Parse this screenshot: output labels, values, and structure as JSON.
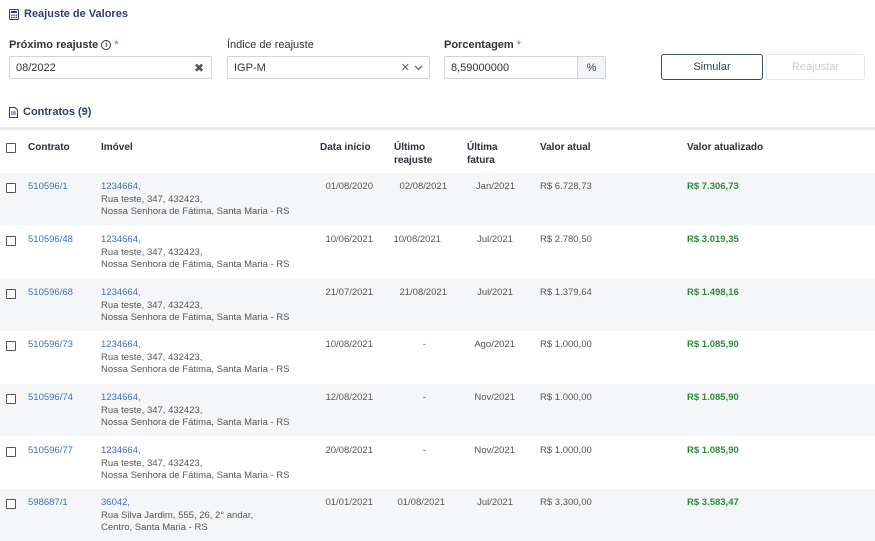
{
  "header": {
    "title": "Reajuste de Valores",
    "icon": "calculator-icon"
  },
  "form": {
    "next_adjustment": {
      "label": "Próximo reajuste",
      "required_mark": "*",
      "value": "08/2022"
    },
    "index": {
      "label": "Índice de reajuste",
      "value": "IGP-M"
    },
    "percentage": {
      "label": "Porcentagem",
      "required_mark": "*",
      "value": "8,59000000",
      "addon": "%"
    },
    "simulate_label": "Simular",
    "adjust_label": "Reajustar"
  },
  "contracts": {
    "title": "Contratos (9)",
    "icon": "document-icon"
  },
  "table": {
    "headers": {
      "contract": "Contrato",
      "property": "Imóvel",
      "start_date": "Data início",
      "last_adjustment_1": "Último",
      "last_adjustment_2": "reajuste",
      "last_invoice_1": "Última",
      "last_invoice_2": "fatura",
      "current_value": "Valor atual",
      "updated_value": "Valor atualizado"
    },
    "rows": [
      {
        "contract": "510596/1",
        "property_code": "1234664,",
        "address1": "Rua teste, 347, 432423,",
        "address2": "Nossa Senhora de Fátima, Santa Maria - RS",
        "start_date": "01/08/2020",
        "last_adjustment": "02/08/2021",
        "last_invoice": "Jan/2021",
        "current_value": "R$ 6.728,73",
        "updated_value": "R$ 7.306,73"
      },
      {
        "contract": "510596/48",
        "property_code": "1234664,",
        "address1": "Rua teste, 347, 432423,",
        "address2": "Nossa Senhora de Fátima, Santa Maria - RS",
        "start_date": "10/06/2021",
        "last_adjustment": "10/08/2021",
        "last_invoice": "Jul/2021",
        "current_value": "R$ 2.780,50",
        "updated_value": "R$ 3.019,35"
      },
      {
        "contract": "510596/68",
        "property_code": "1234664,",
        "address1": "Rua teste, 347, 432423,",
        "address2": "Nossa Senhora de Fátima, Santa Maria - RS",
        "start_date": "21/07/2021",
        "last_adjustment": "21/08/2021",
        "last_invoice": "Jul/2021",
        "current_value": "R$ 1.379,64",
        "updated_value": "R$ 1.498,16"
      },
      {
        "contract": "510596/73",
        "property_code": "1234664,",
        "address1": "Rua teste, 347, 432423,",
        "address2": "Nossa Senhora de Fátima, Santa Maria - RS",
        "start_date": "10/08/2021",
        "last_adjustment": "-",
        "last_invoice": "Ago/2021",
        "current_value": "R$ 1.000,00",
        "updated_value": "R$ 1.085,90"
      },
      {
        "contract": "510596/74",
        "property_code": "1234664,",
        "address1": "Rua teste, 347, 432423,",
        "address2": "Nossa Senhora de Fátima, Santa Maria - RS",
        "start_date": "12/08/2021",
        "last_adjustment": "-",
        "last_invoice": "Nov/2021",
        "current_value": "R$ 1.000,00",
        "updated_value": "R$ 1.085,90"
      },
      {
        "contract": "510596/77",
        "property_code": "1234664,",
        "address1": "Rua teste, 347, 432423,",
        "address2": "Nossa Senhora de Fátima, Santa Maria - RS",
        "start_date": "20/08/2021",
        "last_adjustment": "-",
        "last_invoice": "Nov/2021",
        "current_value": "R$ 1.000,00",
        "updated_value": "R$ 1.085,90"
      },
      {
        "contract": "598687/1",
        "property_code": "36042,",
        "address1": "Rua Silva Jardim, 555, 26, 2° andar,",
        "address2": "Centro, Santa Maria - RS",
        "start_date": "01/01/2021",
        "last_adjustment": "01/08/2021",
        "last_invoice": "Jul/2021",
        "current_value": "R$ 3.300,00",
        "updated_value": "R$ 3.583,47"
      }
    ]
  },
  "colors": {
    "accent": "#2a3f6a",
    "link": "#3b6fc4",
    "positive": "#2e8b3a",
    "required": "#e0464b"
  }
}
